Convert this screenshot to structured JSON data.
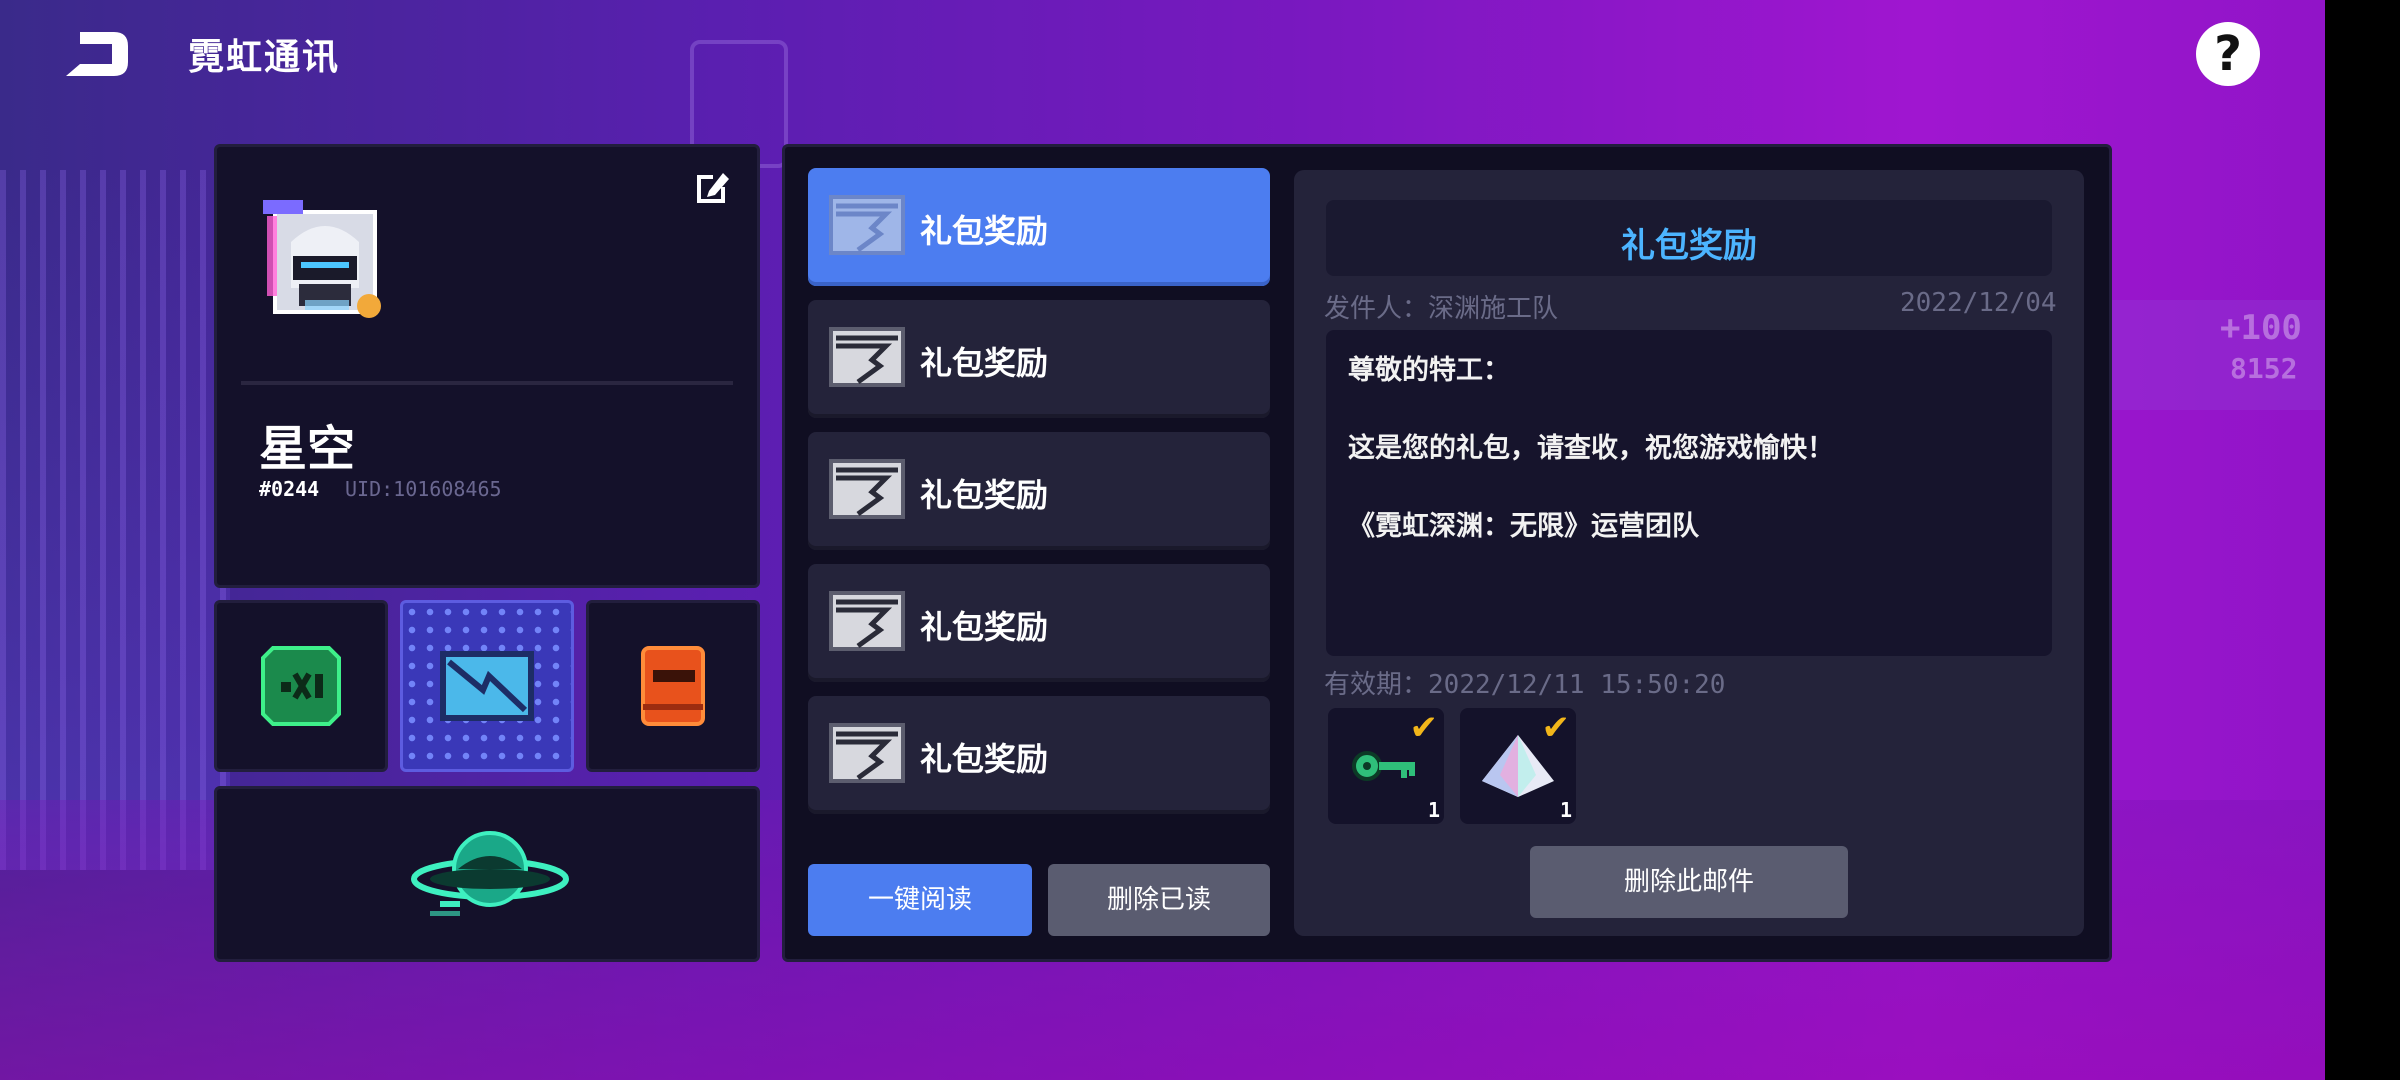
{
  "header": {
    "title": "霓虹通讯",
    "help_label": "?"
  },
  "background": {
    "score_text": "+100",
    "score_sub": "8152"
  },
  "profile": {
    "name": "星空",
    "tag": "#0244",
    "uid": "UID:101608465"
  },
  "mail_list": {
    "items": [
      {
        "label": "礼包奖励",
        "active": true
      },
      {
        "label": "礼包奖励",
        "active": false
      },
      {
        "label": "礼包奖励",
        "active": false
      },
      {
        "label": "礼包奖励",
        "active": false
      },
      {
        "label": "礼包奖励",
        "active": false
      }
    ],
    "read_all_label": "一键阅读",
    "delete_read_label": "删除已读"
  },
  "detail": {
    "title": "礼包奖励",
    "sender": "发件人：深渊施工队",
    "date": "2022/12/04",
    "body": [
      "尊敬的特工：",
      "这是您的礼包，请查收，祝您游戏愉快！",
      "《霓虹深渊：无限》运营团队"
    ],
    "expiry_label": "有效期：",
    "expiry_value": "2022/12/11 15:50:20",
    "rewards": [
      {
        "icon": "key-icon",
        "qty": "1",
        "claimed": true
      },
      {
        "icon": "crystal-icon",
        "qty": "1",
        "claimed": true
      }
    ],
    "delete_label": "删除此邮件"
  },
  "colors": {
    "accent_blue": "#4c7df0",
    "title_blue": "#4cb4ff",
    "check_gold": "#f2b61a",
    "panel_dark": "#14112a"
  }
}
